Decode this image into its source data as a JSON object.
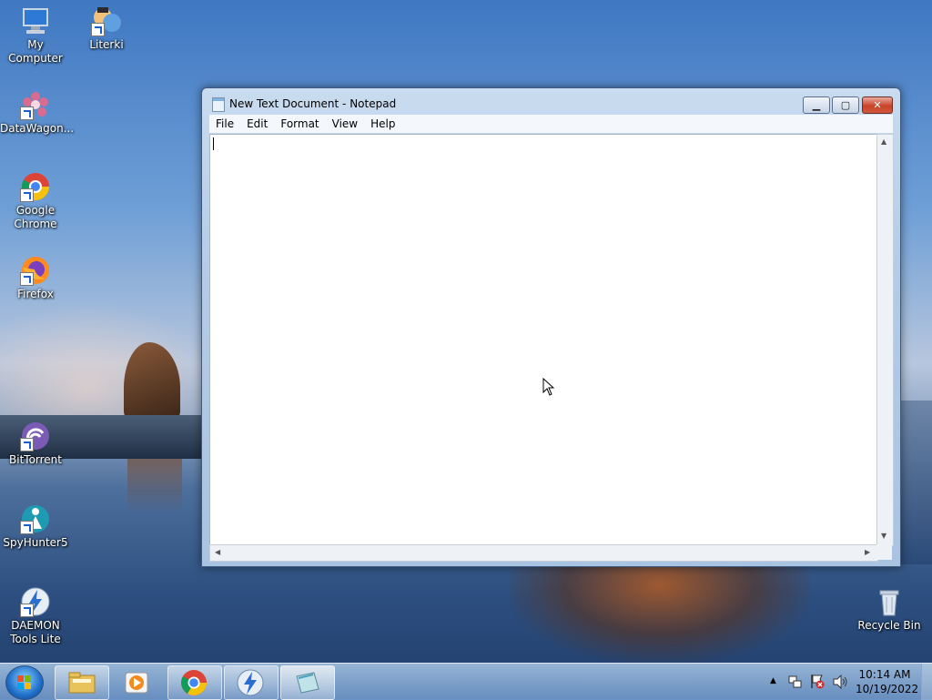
{
  "desktop": {
    "icons": [
      {
        "label": "My Computer",
        "icon": "computer-icon"
      },
      {
        "label": "Literki",
        "icon": "literki-icon"
      },
      {
        "label": "DataWagon...",
        "icon": "datawagon-icon"
      },
      {
        "label": "Google Chrome",
        "icon": "chrome-icon"
      },
      {
        "label": "Firefox",
        "icon": "firefox-icon"
      },
      {
        "label": "BitTorrent",
        "icon": "bittorrent-icon"
      },
      {
        "label": "SpyHunter5",
        "icon": "spyhunter-icon"
      },
      {
        "label": "DAEMON Tools Lite",
        "icon": "daemon-tools-icon"
      },
      {
        "label": "Recycle Bin",
        "icon": "recycle-bin-icon"
      }
    ]
  },
  "window": {
    "title": "New Text Document - Notepad",
    "menu": [
      "File",
      "Edit",
      "Format",
      "View",
      "Help"
    ],
    "content": ""
  },
  "taskbar": {
    "pinned": [
      "file-explorer-icon",
      "media-player-icon",
      "chrome-icon",
      "daemon-tools-icon",
      "notepad-icon"
    ],
    "tray_icons": [
      "show-hidden-icon",
      "network-icon",
      "action-center-icon",
      "volume-icon"
    ],
    "time": "10:14 AM",
    "date": "10/19/2022"
  },
  "colors": {
    "close_button": "#c9442b",
    "window_frame": "#b3cbe6"
  }
}
